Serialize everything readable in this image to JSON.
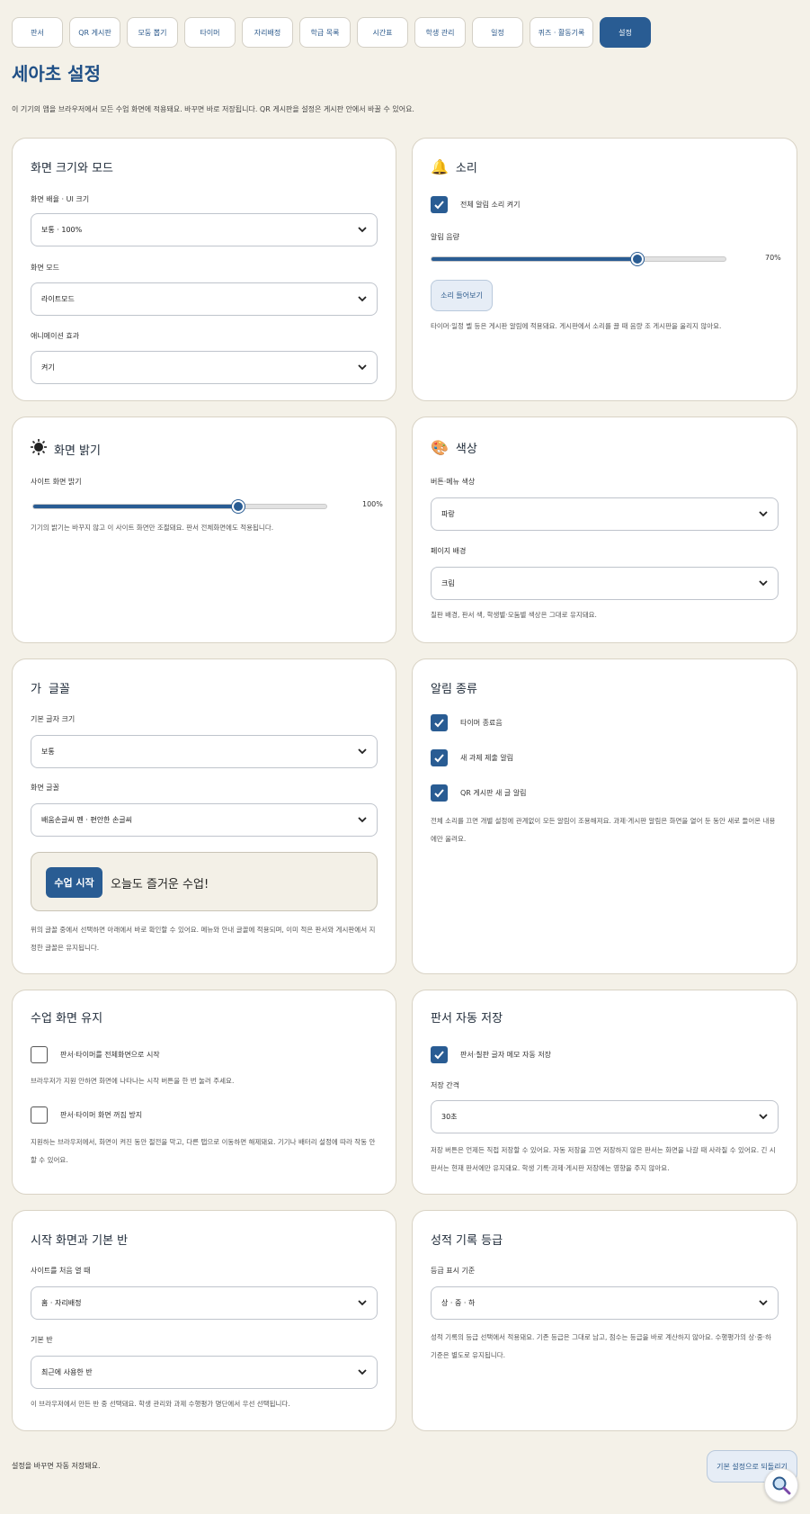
{
  "tabs": [
    {
      "label": "판서"
    },
    {
      "label": "QR 게시판"
    },
    {
      "label": "모둠 뽑기"
    },
    {
      "label": "타이머"
    },
    {
      "label": "자리배정"
    },
    {
      "label": "학급 목록"
    },
    {
      "label": "시간표"
    },
    {
      "label": "학생 관리"
    },
    {
      "label": "일정"
    },
    {
      "label": "퀴즈 · 활동기록"
    },
    {
      "label": "설정"
    }
  ],
  "page": {
    "title": "세아초 설정",
    "description": "이 기기의 앱을 브라우저에서 모든 수업 화면에 적용돼요. 바꾸면 바로 저장됩니다. QR 게시판을 설정은 게시판 안에서 바꿀 수 있어요."
  },
  "display": {
    "title": "화면 크기와 모드",
    "scale_label": "화면 배율 · UI 크기",
    "scale_value": "보통 · 100%",
    "mode_label": "화면 모드",
    "mode_value": "라이트모드",
    "animation_label": "애니메이션 효과",
    "animation_value": "켜기"
  },
  "sound": {
    "title": "소리",
    "mute_label": "전체 알림 소리 켜기",
    "mute_checked": true,
    "volume_label": "알림 음량",
    "volume_value": 0.7,
    "volume_text": "70%",
    "test_button": "소리 들어보기",
    "note": "타이머·일정 벨 등은 게시판 알림에 적용돼요. 게시판에서 소리를 끌 때 음량 조 게시판을 울리지 않아요."
  },
  "brightness": {
    "title": "화면 밝기",
    "label": "사이트 화면 밝기",
    "value": 0.7,
    "value_text": "100%",
    "note": "기기의 밝기는 바꾸지 않고 이 사이트 화면만 조절돼요. 판서 전체화면에도 적용됩니다."
  },
  "colors": {
    "title": "색상",
    "button_label": "버튼·메뉴 색상",
    "button_value": "파랑",
    "bg_label": "페이지 배경",
    "bg_value": "크림",
    "note": "칠판 배경, 판서 색, 학생별·모둠별 색상은 그대로 유지돼요."
  },
  "fonts": {
    "title": "글꼴",
    "size_label": "기본 글자 크기",
    "size_value": "보통",
    "font_label": "화면 글꼴",
    "font_value": "배움손글씨 펜 · 편안한 손글씨",
    "preview_button": "수업 시작",
    "preview_text": "오늘도 즐거운 수업!",
    "note": "위의 글꼴 중에서 선택하면 아래에서 바로 확인할 수 있어요. 메뉴와 안내 글꼴에 적용되며, 이미 적은 판서와 게시판에서 지정한 글꼴은 유지됩니다."
  },
  "alerts": {
    "title": "알림 종류",
    "items": [
      {
        "label": "타이머 종료음",
        "checked": true
      },
      {
        "label": "새 과제 제출 알림",
        "checked": true
      },
      {
        "label": "QR 게시판 새 글 알림",
        "checked": true
      }
    ],
    "note": "전체 소리를 끄면 개별 설정에 관계없이 모든 알림이 조용해져요. 과제·게시판 알림은 화면을 열어 둔 동안 새로 들어온 내용에만 울려요."
  },
  "keep": {
    "title": "수업 화면 유지",
    "items": [
      {
        "label": "판서·타이머를 전체화면으로 시작",
        "checked": false,
        "note": "브라우저가 지원 안하면 화면에 나타나는 시작 버튼을 한 번 눌러 주세요."
      },
      {
        "label": "판서·타이머 화면 꺼짐 방지",
        "checked": false,
        "note": "지원하는 브라우저에서, 화면이 켜진 동안 절전을 막고, 다른 탭으로 이동하면 해제돼요. 기기나 배터리 설정에 따라 작동 안 할 수 있어요."
      }
    ]
  },
  "autosave": {
    "title": "판서 자동 저장",
    "check_label": "판서·칠판 글자 메모 자동 저장",
    "checked": true,
    "interval_label": "저장 간격",
    "interval_value": "30초",
    "note": "저장 버튼은 언제든 직접 저장할 수 있어요. 자동 저장을 끄면 저장하지 않은 판서는 화면을 나갈 때 사라질 수 있어요. 긴 시 판서는 현재 판서에만 유지돼요. 학생 기록·과제·게시판 저장에는 영향을 주지 않아요."
  },
  "start": {
    "title": "시작 화면과 기본 반",
    "open_label": "사이트를 처음 열 때",
    "open_value": "홈 · 자리배정",
    "class_label": "기본 반",
    "class_value": "최근에 사용한 반",
    "note": "이 브라우저에서 만든 반 중 선택돼요. 학생 관리와 과제 수행평가 명단에서 우선 선택됩니다."
  },
  "grades": {
    "title": "성적 기록 등급",
    "label": "등급 표시 기준",
    "value": "상 · 중 · 하",
    "note": "성적 기록의 등급 선택에서 적용돼요. 기존 등급은 그대로 남고, 점수는 등급을 바로 계산하지 않아요. 수행평가의 상·중·하 기준은 별도로 유지됩니다."
  },
  "footer": {
    "note": "설정을 바꾸면 자동 저장돼요.",
    "reset_button": "기본 설정으로 되돌리기"
  },
  "colors_theme": {
    "accent": "#295c93",
    "background": "#f4f1e8"
  }
}
